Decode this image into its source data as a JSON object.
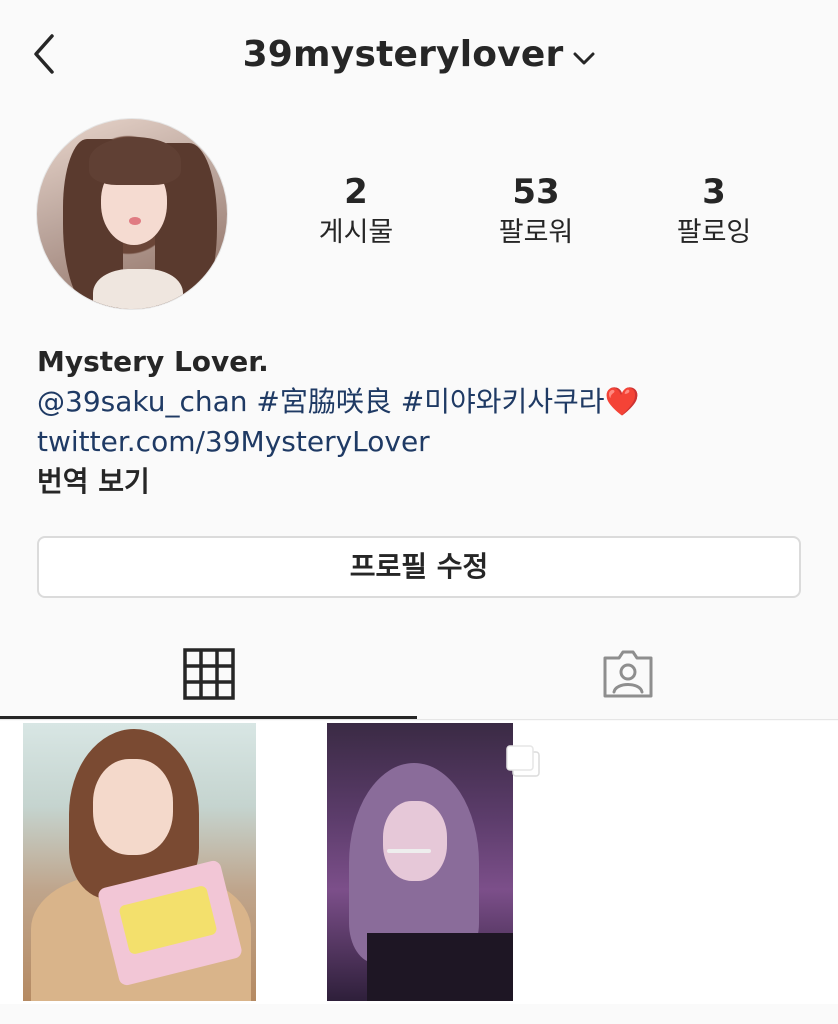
{
  "header": {
    "username": "39mysterylover",
    "back_icon": "chevron-left-icon",
    "dropdown_icon": "chevron-down-icon"
  },
  "profile": {
    "stats": [
      {
        "value": "2",
        "label": "게시물"
      },
      {
        "value": "53",
        "label": "팔로워"
      },
      {
        "value": "3",
        "label": "팔로잉"
      }
    ],
    "display_name": "Mystery Lover.",
    "bio_mention": "@39saku_chan #宮脇咲良 #미야와키사쿠라",
    "bio_heart": "❤️",
    "link": "twitter.com/39MysteryLover",
    "translate": "번역 보기"
  },
  "actions": {
    "edit_profile": "프로필 수정"
  },
  "tabs": {
    "grid_icon": "grid-icon",
    "tagged_icon": "tagged-person-icon",
    "active": "grid"
  },
  "colors": {
    "link": "#1f3a64",
    "text": "#262626",
    "background": "#fafafa",
    "border": "#dbdbdb"
  }
}
